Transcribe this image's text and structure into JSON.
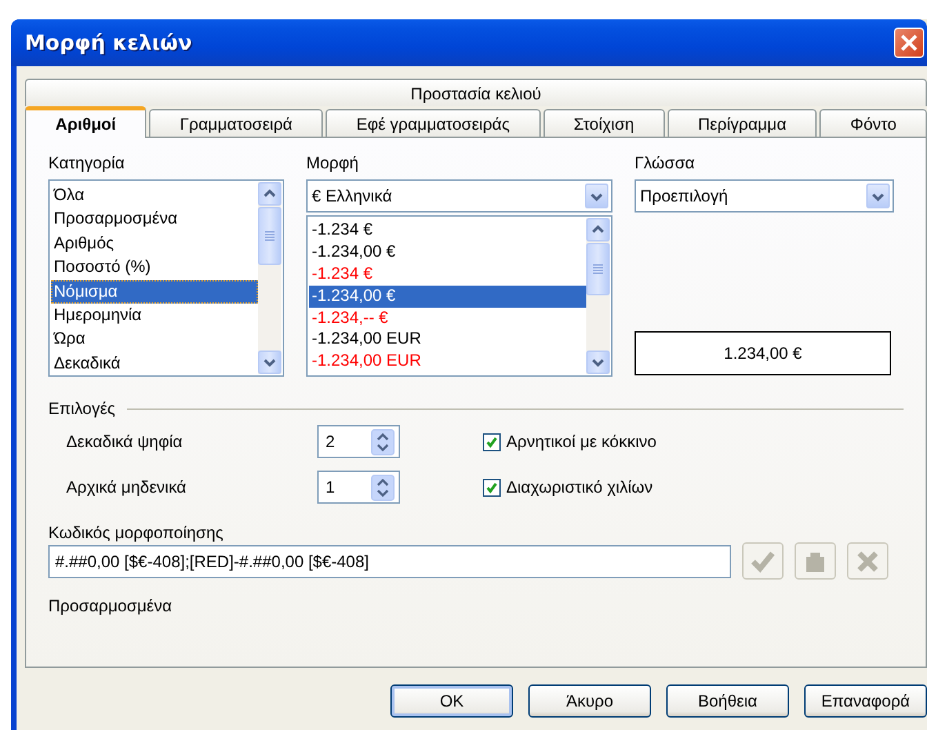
{
  "window": {
    "title": "Μορφή κελιών"
  },
  "tabs_top": [
    {
      "label": "Προστασία κελιού",
      "selected": false
    }
  ],
  "tabs": [
    {
      "label": "Αριθμοί",
      "selected": true
    },
    {
      "label": "Γραμματοσειρά",
      "selected": false
    },
    {
      "label": "Εφέ γραμματοσειράς",
      "selected": false
    },
    {
      "label": "Στοίχιση",
      "selected": false
    },
    {
      "label": "Περίγραμμα",
      "selected": false
    },
    {
      "label": "Φόντο",
      "selected": false
    }
  ],
  "category": {
    "label": "Κατηγορία",
    "items": [
      {
        "text": "Όλα",
        "selected": false
      },
      {
        "text": "Προσαρμοσμένα",
        "selected": false
      },
      {
        "text": "Αριθμός",
        "selected": false
      },
      {
        "text": "Ποσοστό (%)",
        "selected": false
      },
      {
        "text": "Νόμισμα",
        "selected": true
      },
      {
        "text": "Ημερομηνία",
        "selected": false
      },
      {
        "text": "Ώρα",
        "selected": false
      },
      {
        "text": "Δεκαδικά",
        "selected": false
      }
    ]
  },
  "format": {
    "label": "Μορφή",
    "value": "€ Ελληνικά",
    "items": [
      {
        "text": "-1.234 €",
        "color": "#000000",
        "selected": false
      },
      {
        "text": "-1.234,00 €",
        "color": "#000000",
        "selected": false
      },
      {
        "text": "-1.234 €",
        "color": "#ff0000",
        "selected": false
      },
      {
        "text": "-1.234,00 €",
        "color": "#ffffff",
        "selected": true
      },
      {
        "text": "-1.234,-- €",
        "color": "#ff0000",
        "selected": false
      },
      {
        "text": "-1.234,00 EUR",
        "color": "#000000",
        "selected": false
      },
      {
        "text": "-1.234,00 EUR",
        "color": "#ff0000",
        "selected": false
      }
    ]
  },
  "language": {
    "label": "Γλώσσα",
    "value": "Προεπιλογή"
  },
  "preview": "1.234,00 €",
  "options": {
    "title": "Επιλογές",
    "spins": [
      {
        "label": "Δεκαδικά ψηφία",
        "value": "2"
      },
      {
        "label": "Αρχικά μηδενικά",
        "value": "1"
      }
    ],
    "checks": [
      {
        "label": "Αρνητικοί με κόκκινο",
        "checked": true
      },
      {
        "label": "Διαχωριστικό χιλίων",
        "checked": true
      }
    ]
  },
  "format_code": {
    "label": "Κωδικός μορφοποίησης",
    "value": "#.##0,00 [$€-408];[RED]-#.##0,00 [$€-408]",
    "buttons": [
      {
        "kind": "accept",
        "disabled": true
      },
      {
        "kind": "comment",
        "disabled": true
      },
      {
        "kind": "delete",
        "disabled": true
      }
    ]
  },
  "comment": "Προσαρμοσμένα",
  "buttons": [
    {
      "label": "OK",
      "default": true
    },
    {
      "label": "Άκυρο",
      "default": false
    },
    {
      "label": "Βοήθεια",
      "default": false
    },
    {
      "label": "Επαναφορά",
      "default": false
    }
  ]
}
